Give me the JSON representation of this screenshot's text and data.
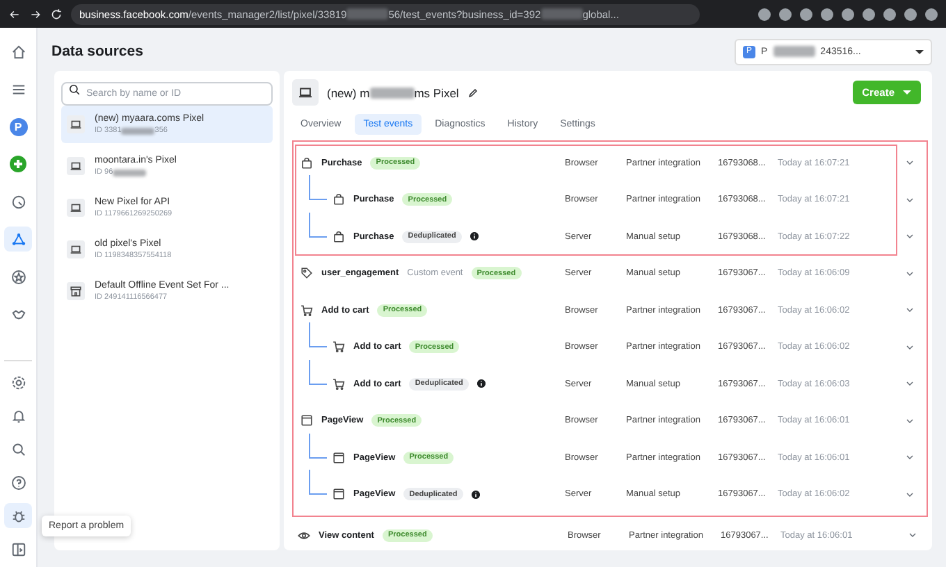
{
  "browser": {
    "host": "business.facebook.com",
    "url_parts": [
      "/events_manager2/list/pixel/33819",
      "56/test_events?business_id=392",
      "global..."
    ]
  },
  "nav": {
    "top": [
      {
        "kind": "home",
        "selected": false
      },
      {
        "kind": "menu",
        "selected": false
      },
      {
        "kind": "avatar",
        "label": "P",
        "selected": false
      },
      {
        "kind": "add",
        "selected": false
      },
      {
        "kind": "gauge",
        "selected": false
      },
      {
        "kind": "network",
        "selected": true
      },
      {
        "kind": "star",
        "selected": false
      },
      {
        "kind": "handshake",
        "selected": false
      }
    ],
    "bottom": [
      {
        "kind": "settings",
        "selected": false
      },
      {
        "kind": "bell",
        "selected": false
      },
      {
        "kind": "search",
        "selected": false
      },
      {
        "kind": "help",
        "selected": false
      },
      {
        "kind": "bug",
        "selected": true
      },
      {
        "kind": "panel",
        "selected": false
      }
    ],
    "tooltip": "Report a problem"
  },
  "page_title": "Data sources",
  "account": {
    "badge": "P",
    "name_parts": [
      "P",
      "243516..."
    ]
  },
  "search": {
    "placeholder": "Search by name or ID"
  },
  "sources": [
    {
      "kind": "pixel",
      "name": "(new) myaara.coms Pixel",
      "id_parts": [
        "ID 3381",
        "356"
      ],
      "selected": true
    },
    {
      "kind": "pixel",
      "name": "moontara.in's Pixel",
      "id_parts": [
        "ID 96"
      ],
      "selected": false
    },
    {
      "kind": "pixel",
      "name": "New Pixel for API",
      "id_parts": [
        "ID 1179661269250269"
      ],
      "selected": false
    },
    {
      "kind": "pixel",
      "name": "old pixel's Pixel",
      "id_parts": [
        "ID 1198348357554118"
      ],
      "selected": false
    },
    {
      "kind": "offline",
      "name": "Default Offline Event Set For ...",
      "id_parts": [
        "ID 249141116566477"
      ],
      "selected": false
    }
  ],
  "detail": {
    "title_parts": [
      "(new) m",
      "ms Pixel"
    ],
    "create_button": "Create",
    "tabs": [
      {
        "label": "Overview",
        "selected": false
      },
      {
        "label": "Test events",
        "selected": true
      },
      {
        "label": "Diagnostics",
        "selected": false
      },
      {
        "label": "History",
        "selected": false
      },
      {
        "label": "Settings",
        "selected": false
      }
    ],
    "events": [
      {
        "kind": "bag",
        "name": "Purchase",
        "status": "Processed",
        "deduplicated": false,
        "source": "Browser",
        "method": "Partner integration",
        "event_id": "16793068...",
        "time": "Today at 16:07:21",
        "highlighted": true,
        "focused": true,
        "children": [
          {
            "kind": "bag",
            "name": "Purchase",
            "status": "Processed",
            "deduplicated": false,
            "source": "Browser",
            "method": "Partner integration",
            "event_id": "16793068...",
            "time": "Today at 16:07:21"
          },
          {
            "kind": "bag",
            "name": "Purchase",
            "status": "Deduplicated",
            "deduplicated": true,
            "source": "Server",
            "method": "Manual setup",
            "event_id": "16793068...",
            "time": "Today at 16:07:22"
          }
        ]
      },
      {
        "kind": "tag",
        "name": "user_engagement",
        "note": "Custom event",
        "status": "Processed",
        "deduplicated": false,
        "source": "Server",
        "method": "Manual setup",
        "event_id": "16793067...",
        "time": "Today at 16:06:09",
        "highlighted": true,
        "focused": false
      },
      {
        "kind": "cart",
        "name": "Add to cart",
        "status": "Processed",
        "deduplicated": false,
        "source": "Browser",
        "method": "Partner integration",
        "event_id": "16793067...",
        "time": "Today at 16:06:02",
        "highlighted": true,
        "focused": false,
        "children": [
          {
            "kind": "cart",
            "name": "Add to cart",
            "status": "Processed",
            "deduplicated": false,
            "source": "Browser",
            "method": "Partner integration",
            "event_id": "16793067...",
            "time": "Today at 16:06:02"
          },
          {
            "kind": "cart",
            "name": "Add to cart",
            "status": "Deduplicated",
            "deduplicated": true,
            "source": "Server",
            "method": "Manual setup",
            "event_id": "16793067...",
            "time": "Today at 16:06:03"
          }
        ]
      },
      {
        "kind": "page",
        "name": "PageView",
        "status": "Processed",
        "deduplicated": false,
        "source": "Browser",
        "method": "Partner integration",
        "event_id": "16793067...",
        "time": "Today at 16:06:01",
        "highlighted": true,
        "focused": false,
        "children": [
          {
            "kind": "page",
            "name": "PageView",
            "status": "Processed",
            "deduplicated": false,
            "source": "Browser",
            "method": "Partner integration",
            "event_id": "16793067...",
            "time": "Today at 16:06:01"
          },
          {
            "kind": "page",
            "name": "PageView",
            "status": "Deduplicated",
            "deduplicated": true,
            "source": "Server",
            "method": "Manual setup",
            "event_id": "16793067...",
            "time": "Today at 16:06:02"
          }
        ]
      },
      {
        "kind": "eye",
        "name": "View content",
        "status": "Processed",
        "deduplicated": false,
        "source": "Browser",
        "method": "Partner integration",
        "event_id": "16793067...",
        "time": "Today at 16:06:01",
        "highlighted": false,
        "focused": false
      }
    ]
  }
}
